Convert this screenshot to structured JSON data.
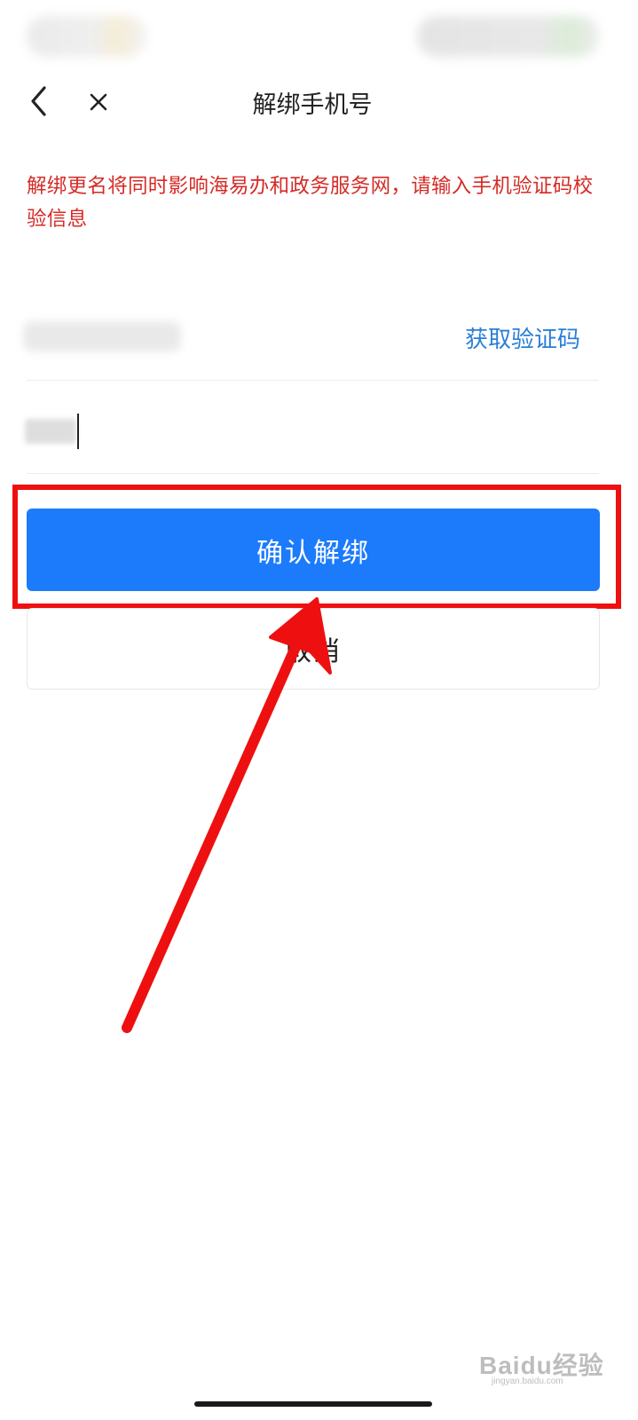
{
  "status_bar": {
    "left_icons": "blurred-status-left",
    "right_icons": "blurred-status-right"
  },
  "nav": {
    "back_icon": "chevron-left-icon",
    "close_icon": "close-icon",
    "title": "解绑手机号"
  },
  "warning": {
    "text": "解绑更名将同时影响海易办和政务服务网，请输入手机验证码校验信息",
    "color": "#d42b26"
  },
  "form": {
    "phone": {
      "value": ""
    },
    "get_code_label": "获取验证码",
    "code": {
      "value": ""
    }
  },
  "buttons": {
    "confirm_label": "确认解绑",
    "cancel_label": "取消"
  },
  "watermark": {
    "main": "Baidu经验",
    "sub": "jingyan.baidu.com"
  },
  "colors": {
    "primary": "#1c7bfb",
    "link": "#2a7fd6",
    "annotation_red": "#ee1010"
  }
}
